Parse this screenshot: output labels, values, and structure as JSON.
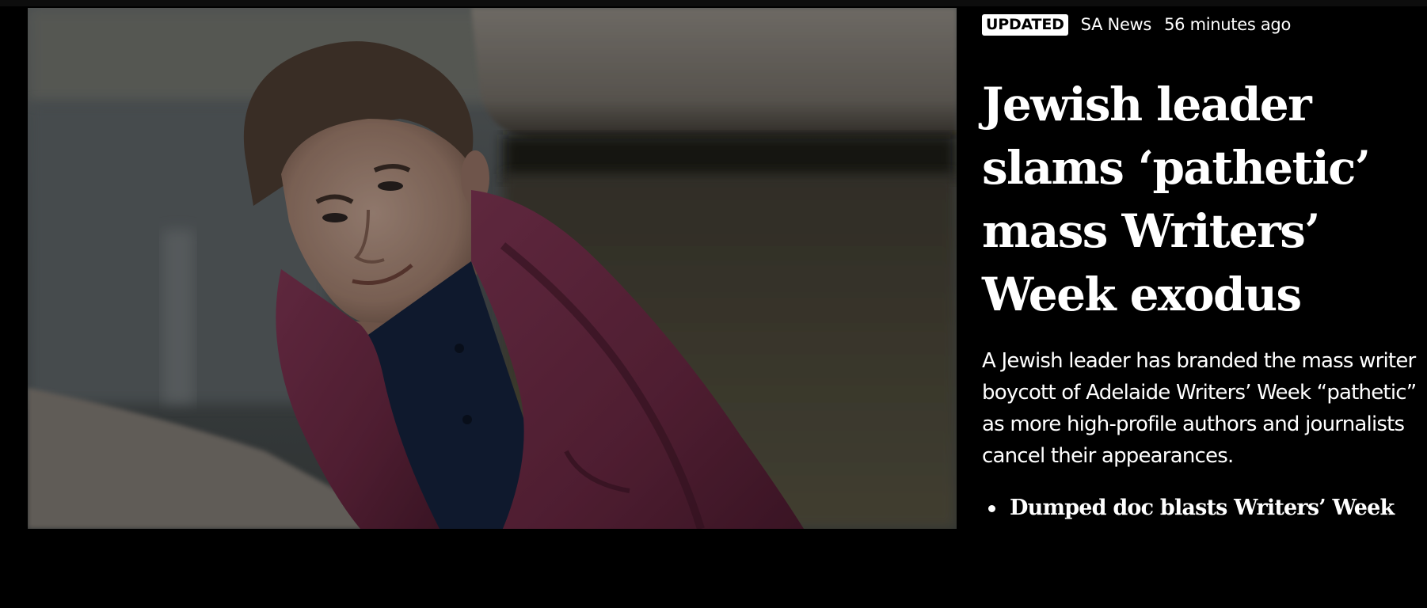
{
  "story": {
    "badge": "UPDATED",
    "source": "SA News",
    "time": "56 minutes ago",
    "headline": "Jewish leader slams ‘pathetic’ mass Writers’ Week exodus",
    "summary": "A Jewish leader has branded the mass writer boycott of Adelaide Writers’ Week “pathetic” as more high-profile authors and journalists cancel their appearances.",
    "related": [
      {
        "label": "Dumped doc blasts Writers’ Week"
      }
    ]
  },
  "colors": {
    "background": "#000000",
    "text": "#ffffff",
    "badge_bg": "#ffffff",
    "badge_text": "#000000",
    "jacket": "#6e2a45",
    "shirt": "#14213a"
  }
}
